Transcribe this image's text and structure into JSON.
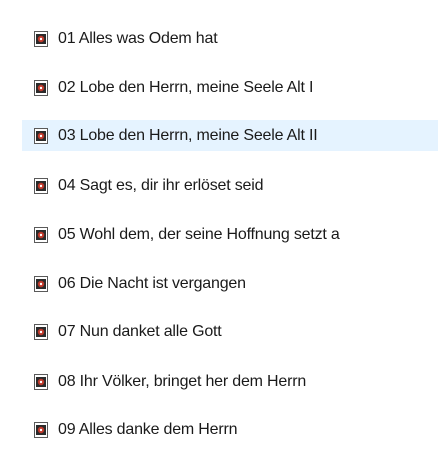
{
  "file_list": {
    "selected_index": 2,
    "items": [
      {
        "name": "01 Alles was Odem hat",
        "icon": "audio-file-icon"
      },
      {
        "name": "02 Lobe den Herrn, meine Seele Alt I",
        "icon": "audio-file-icon"
      },
      {
        "name": "03 Lobe den Herrn, meine Seele Alt II",
        "icon": "audio-file-icon"
      },
      {
        "name": "04 Sagt es, dir ihr erlöset seid",
        "icon": "audio-file-icon"
      },
      {
        "name": "05 Wohl dem, der seine Hoffnung setzt a",
        "icon": "audio-file-icon"
      },
      {
        "name": "06 Die Nacht ist vergangen",
        "icon": "audio-file-icon"
      },
      {
        "name": "07 Nun danket alle Gott",
        "icon": "audio-file-icon"
      },
      {
        "name": "08 Ihr Völker, bringet her dem Herrn",
        "icon": "audio-file-icon"
      },
      {
        "name": "09 Alles danke dem Herrn",
        "icon": "audio-file-icon"
      }
    ]
  },
  "colors": {
    "selection_background": "#e5f3ff",
    "icon_accent": "#c0392b",
    "text": "#1a1a1a"
  }
}
